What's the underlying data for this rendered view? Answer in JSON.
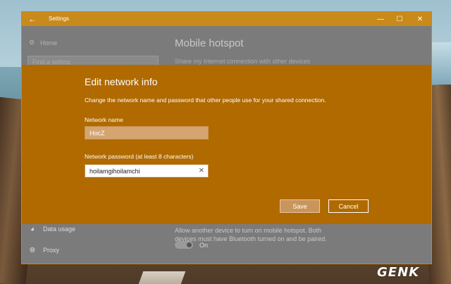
{
  "window": {
    "title": "Settings",
    "back_icon": "arrow-left-icon",
    "controls": {
      "minimize": "—",
      "maximize": "☐",
      "close": "✕"
    }
  },
  "sidebar": {
    "home_label": "Home",
    "search_placeholder": "Find a setting",
    "items": [
      {
        "label": "Data usage",
        "icon": "data-usage-icon"
      },
      {
        "label": "Proxy",
        "icon": "globe-icon"
      }
    ]
  },
  "page": {
    "title": "Mobile hotspot",
    "subtitle": "Share my Internet connection with other devices",
    "bluetooth_text": "Allow another device to turn on mobile hotspot. Both devices must have Bluetooth turned on and be paired.",
    "toggle_label": "On"
  },
  "dialog": {
    "title": "Edit network info",
    "description": "Change the network name and password that other people use for your shared connection.",
    "network_name_label": "Network name",
    "network_name_value": "HocZ",
    "password_label": "Network password (at least 8 characters)",
    "password_value": "hoilamgihoilamchi",
    "save_label": "Save",
    "cancel_label": "Cancel"
  },
  "watermark": "GENK",
  "colors": {
    "accent": "#b06a00",
    "titlebar": "#c88a1a"
  }
}
